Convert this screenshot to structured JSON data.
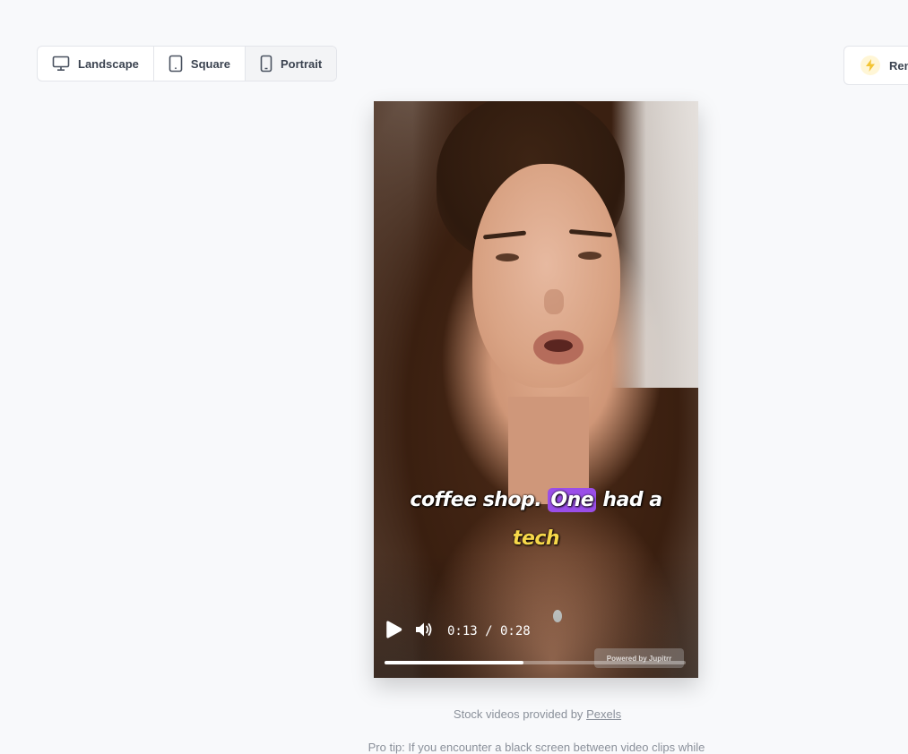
{
  "format_toggle": {
    "options": [
      {
        "label": "Landscape",
        "icon": "monitor-icon",
        "active": false
      },
      {
        "label": "Square",
        "icon": "tablet-icon",
        "active": false
      },
      {
        "label": "Portrait",
        "icon": "phone-icon",
        "active": true
      }
    ]
  },
  "render_button": {
    "label": "Ren",
    "icon": "lightning-bolt-icon"
  },
  "video": {
    "caption_line1_before": "coffee shop.",
    "caption_highlight": "One",
    "caption_line1_after": "had a",
    "caption_line2": "tech",
    "current_time": "0:13",
    "duration": "0:28",
    "time_display": "0:13 / 0:28",
    "progress_fraction": 0.46,
    "watermark": "Powered by   Jupitrr",
    "colors": {
      "highlight": "#9a4ee8",
      "keyword": "#f7d84a"
    }
  },
  "footer": {
    "stock_prefix": "Stock videos provided by",
    "stock_link": "Pexels",
    "pro_tip": "Pro tip: If you encounter a black screen between video clips while"
  }
}
